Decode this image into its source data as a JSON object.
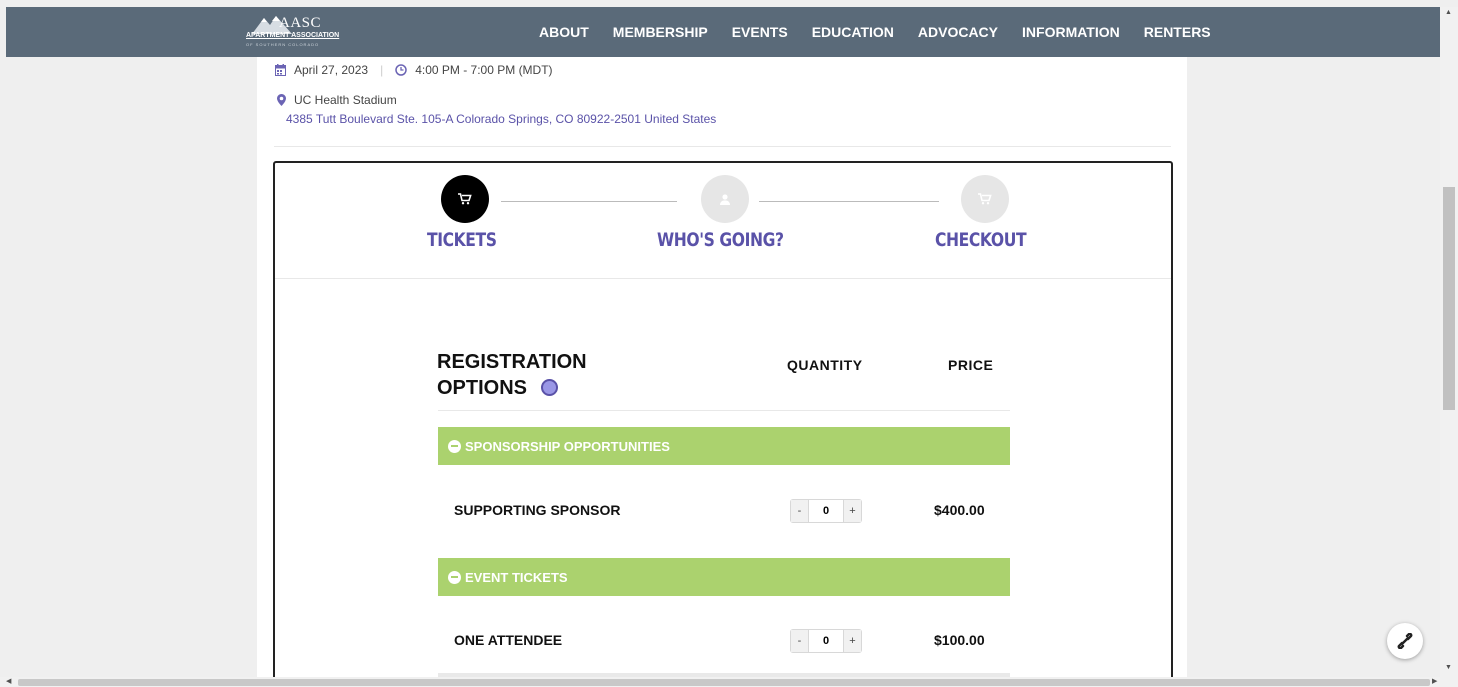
{
  "nav": {
    "logo_text": "AASC",
    "logo_subtitle": "APARTMENT ASSOCIATION",
    "logo_tagline": "OF SOUTHERN COLORADO",
    "links": [
      "ABOUT",
      "MEMBERSHIP",
      "EVENTS",
      "EDUCATION",
      "ADVOCACY",
      "INFORMATION",
      "RENTERS"
    ],
    "bg_color": "#5a6a79"
  },
  "event": {
    "date": "April 27, 2023",
    "time": "4:00 PM - 7:00 PM (MDT)",
    "venue": "UC Health Stadium",
    "address": "4385 Tutt Boulevard Ste. 105-A Colorado Springs, CO 80922-2501 United States",
    "icons": {
      "date": "calendar-icon",
      "time": "clock-icon",
      "venue": "map-pin-icon"
    }
  },
  "steps": [
    {
      "label": "TICKETS",
      "icon": "cart-icon",
      "active": true
    },
    {
      "label": "WHO'S GOING?",
      "icon": "user-icon",
      "active": false
    },
    {
      "label": "CHECKOUT",
      "icon": "cart-icon",
      "active": false
    }
  ],
  "table": {
    "heading_line1": "REGISTRATION",
    "heading_line2": "OPTIONS",
    "quantity_header": "QUANTITY",
    "price_header": "PRICE",
    "categories": [
      {
        "name": "SPONSORSHIP OPPORTUNITIES",
        "tickets": [
          {
            "name": "SUPPORTING SPONSOR",
            "quantity": "0",
            "price": "$400.00"
          }
        ]
      },
      {
        "name": "EVENT TICKETS",
        "tickets": [
          {
            "name": "ONE ATTENDEE",
            "quantity": "0",
            "price": "$100.00"
          }
        ]
      }
    ],
    "stepper_minus": "-",
    "stepper_plus": "+"
  },
  "colors": {
    "accent": "#5a52a8",
    "category_bar": "#abd26e",
    "active_step": "#000000",
    "inactive_step": "#e6e6e6"
  }
}
